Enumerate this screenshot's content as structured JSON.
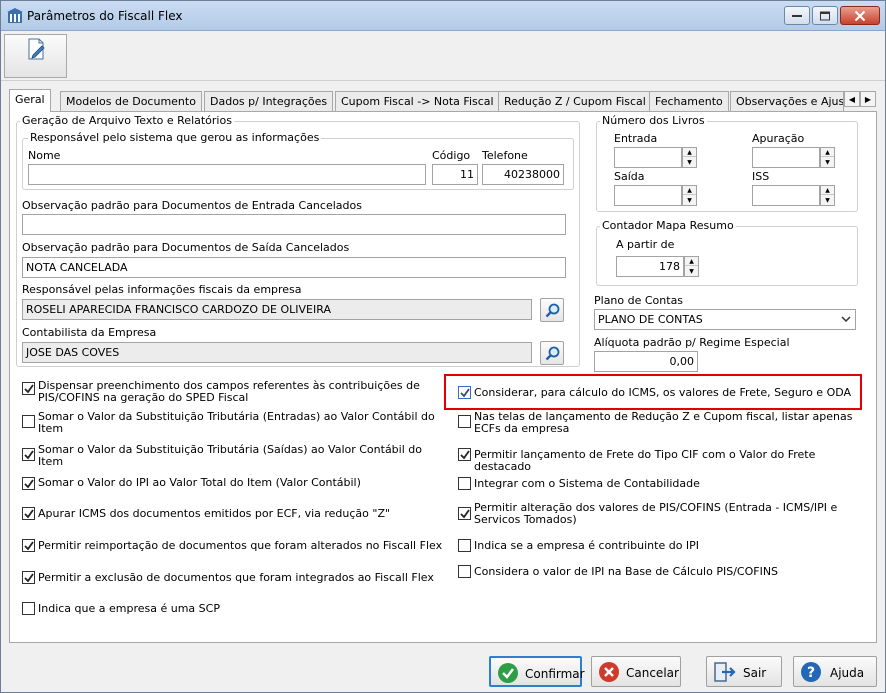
{
  "window": {
    "title": "Parâmetros do Fiscall Flex"
  },
  "toolbar": {
    "edit_label": "Editar"
  },
  "tabs": [
    {
      "label": "Geral",
      "active": true
    },
    {
      "label": "Modelos de Documento"
    },
    {
      "label": "Dados p/ Integrações"
    },
    {
      "label": "Cupom Fiscal -> Nota Fiscal"
    },
    {
      "label": "Redução Z / Cupom Fiscal"
    },
    {
      "label": "Fechamento"
    },
    {
      "label": "Observações e Ajus"
    }
  ],
  "geracao": {
    "title": "Geração de Arquivo Texto e Relatórios",
    "responsavel_group": "Responsável pelo sistema que gerou as informações",
    "nome_label": "Nome",
    "nome_value": "",
    "codigo_label": "Código",
    "codigo_value": "11",
    "telefone_label": "Telefone",
    "telefone_value": "40238000",
    "obs_entrada_label": "Observação padrão para Documentos de Entrada Cancelados",
    "obs_entrada_value": "",
    "obs_saida_label": "Observação padrão para Documentos de Saída Cancelados",
    "obs_saida_value": "NOTA CANCELADA",
    "resp_fiscais_label": "Responsável pelas informações fiscais da empresa",
    "resp_fiscais_value": "ROSELI APARECIDA FRANCISCO CARDOZO DE OLIVEIRA",
    "contabilista_label": "Contabilista da Empresa",
    "contabilista_value": "JOSE DAS COVES"
  },
  "livros": {
    "title": "Número dos Livros",
    "entrada_label": "Entrada",
    "entrada_value": "",
    "apuracao_label": "Apuração",
    "apuracao_value": "",
    "saida_label": "Saída",
    "saida_value": "",
    "iss_label": "ISS",
    "iss_value": ""
  },
  "contador": {
    "title": "Contador Mapa Resumo",
    "a_partir_label": "A partir de",
    "a_partir_value": "178"
  },
  "plano": {
    "label": "Plano de Contas",
    "value": "PLANO DE CONTAS"
  },
  "aliquota": {
    "label": "Alíquota padrão p/ Regime Especial",
    "value": "0,00"
  },
  "checks_left": [
    {
      "label": "Dispensar preenchimento dos campos referentes às contribuições de PIS/COFINS na geração do SPED Fiscal",
      "checked": true
    },
    {
      "label": "Somar o Valor da Substituição Tributária (Entradas) ao Valor Contábil do Item",
      "checked": false
    },
    {
      "label": "Somar o Valor da Substituição Tributária (Saídas) ao Valor Contábil do Item",
      "checked": true
    },
    {
      "label": "Somar o Valor do IPI ao Valor Total do Item (Valor Contábil)",
      "checked": true
    },
    {
      "label": "Apurar ICMS dos documentos emitidos por ECF, via redução \"Z\"",
      "checked": true
    },
    {
      "label": "Permitir reimportação de documentos que foram alterados no Fiscall Flex",
      "checked": true
    },
    {
      "label": "Permitir a exclusão de documentos que foram integrados ao Fiscall Flex",
      "checked": true
    },
    {
      "label": "Indica que a empresa é uma SCP",
      "checked": false
    }
  ],
  "checks_right": [
    {
      "label": "Considerar, para cálculo do ICMS, os valores de Frete, Seguro e ODA",
      "checked": true
    },
    {
      "label": "Nas telas de lançamento de Redução Z e Cupom fiscal, listar apenas ECFs da empresa",
      "checked": false
    },
    {
      "label": "Permitir lançamento de Frete do Tipo CIF com o Valor do Frete destacado",
      "checked": true
    },
    {
      "label": "Integrar com o Sistema de Contabilidade",
      "checked": false
    },
    {
      "label": "Permitir alteração dos valores de PIS/COFINS (Entrada - ICMS/IPI e Servicos Tomados)",
      "checked": true
    },
    {
      "label": "Indica se a empresa é contribuinte do IPI",
      "checked": false
    },
    {
      "label": "Considera o valor de IPI na Base de Cálculo PIS/COFINS",
      "checked": false
    }
  ],
  "buttons": {
    "confirmar": "Confirmar",
    "cancelar": "Cancelar",
    "sair": "Sair",
    "ajuda": "Ajuda"
  },
  "colors": {
    "highlight": "#e00000",
    "confirm_green": "#2e9e44",
    "cancel_red": "#d03a2a",
    "help_blue": "#2367b5"
  },
  "icons": [
    "app-icon",
    "minimize-icon",
    "maximize-icon",
    "close-icon",
    "edit-document-icon",
    "search-icon",
    "chevron-down-icon",
    "checkmark-icon",
    "confirm-check-icon",
    "cancel-x-icon",
    "exit-door-icon",
    "help-question-icon"
  ]
}
